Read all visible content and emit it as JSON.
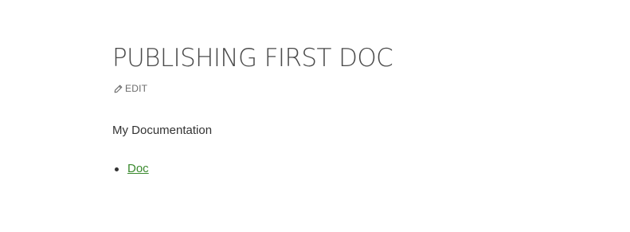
{
  "page": {
    "title": "PUBLISHING FIRST DOC",
    "edit_label": "EDIT",
    "intro": "My Documentation"
  },
  "docs": {
    "items": [
      {
        "label": "Doc"
      }
    ]
  },
  "colors": {
    "title": "#4a4a4a",
    "text": "#333333",
    "muted": "#6b6b6b",
    "link": "#3a8a2e"
  },
  "icons": {
    "edit": "pencil-icon"
  }
}
